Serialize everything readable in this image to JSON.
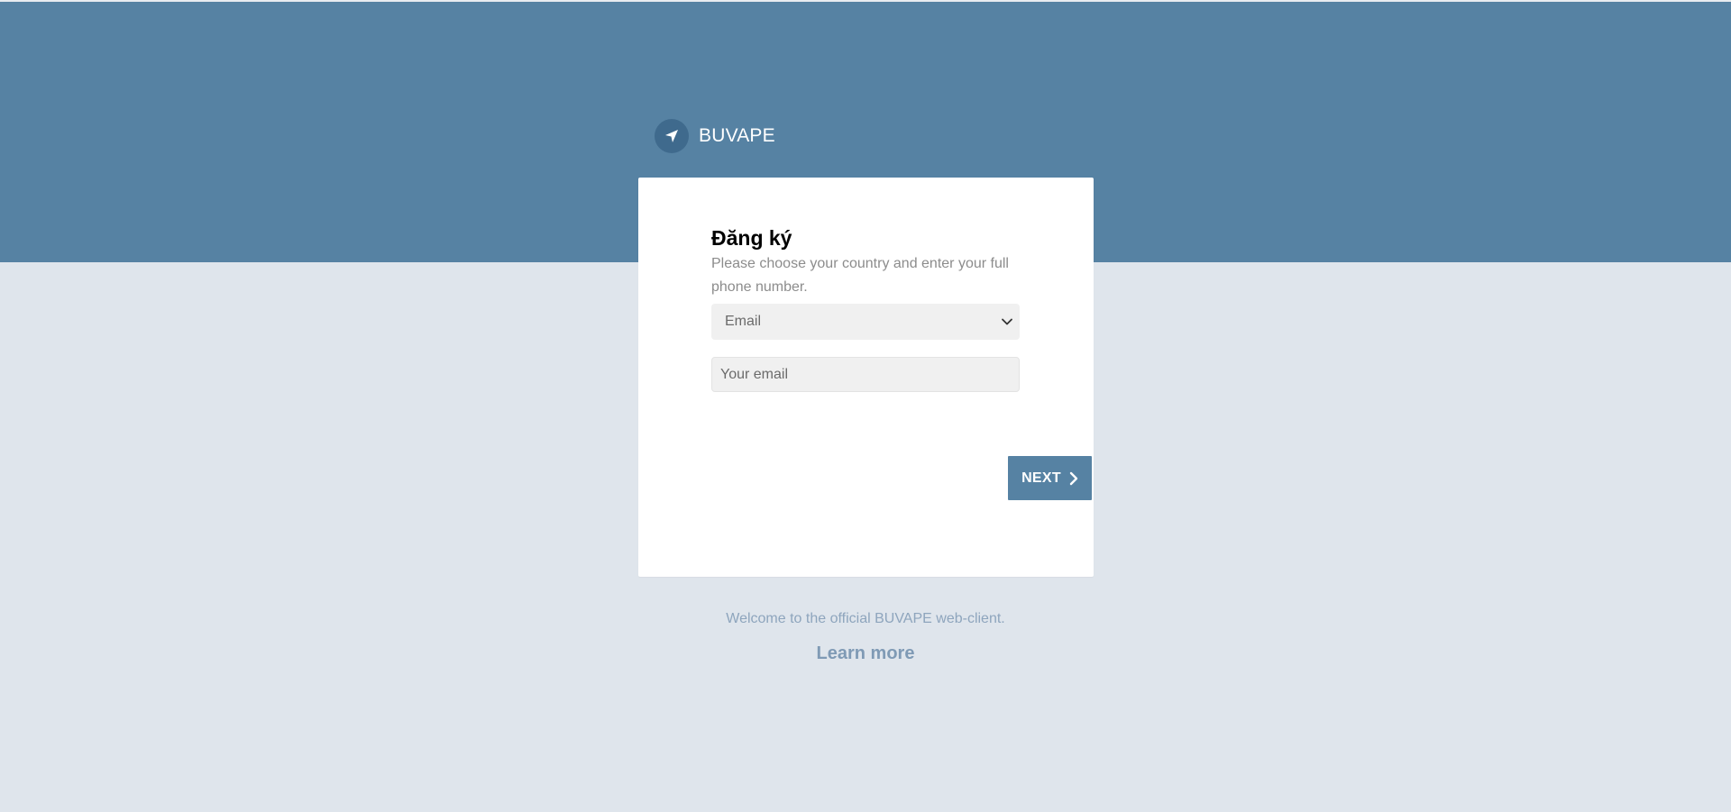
{
  "brand": {
    "name": "BUVAPE",
    "logo_icon": "paper-plane-icon"
  },
  "signup": {
    "title": "Đăng ký",
    "description": "Please choose your country and enter your full phone number.",
    "method_select": {
      "selected": "Email",
      "options": [
        "Email"
      ]
    },
    "email_input": {
      "value": "",
      "placeholder": "Your email"
    },
    "next_button": {
      "label": "NEXT",
      "icon": "chevron-right-icon"
    }
  },
  "footer": {
    "welcome": "Welcome to the official BUVAPE web-client.",
    "learn_more": "Learn more"
  },
  "colors": {
    "header_band": "#5682a3",
    "page_background": "#dfe5ec",
    "card_background": "#ffffff",
    "accent": "#5682a3"
  }
}
